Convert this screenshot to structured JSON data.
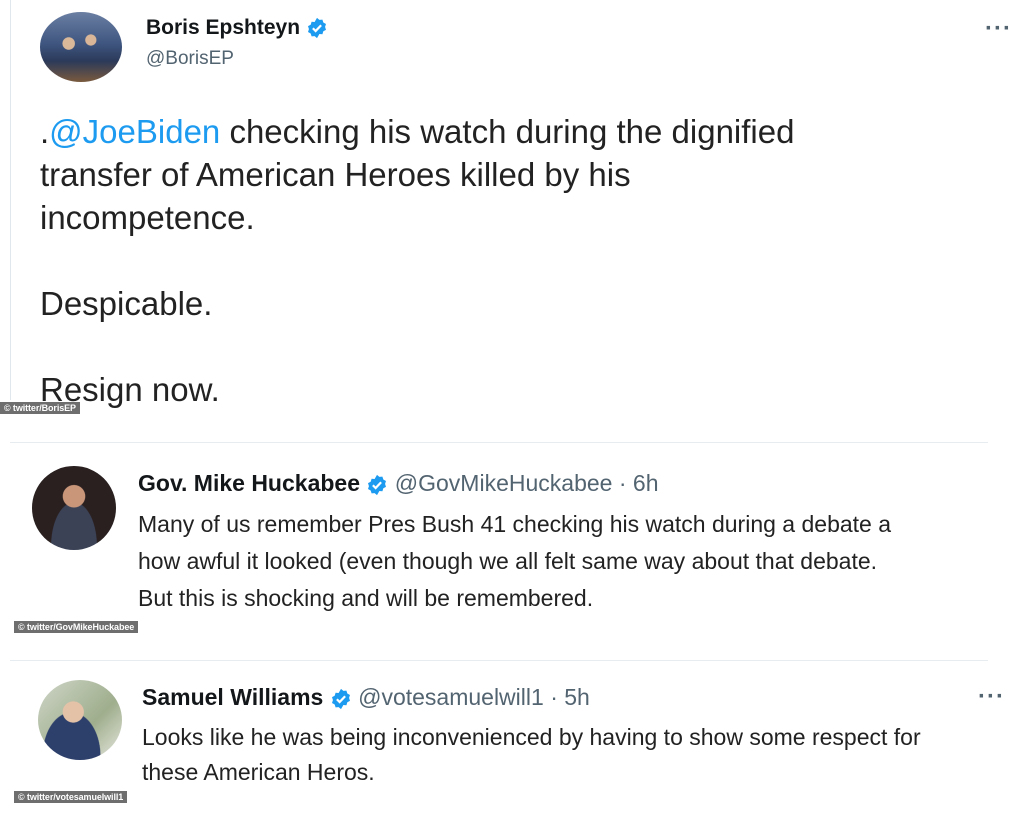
{
  "tweets": [
    {
      "name": "Boris Epshteyn",
      "handle": "@BorisEP",
      "verified": true,
      "mention": "@JoeBiden",
      "prefix": ".",
      "text_after_mention": " checking his watch during the dignified",
      "line2": "transfer of American Heroes killed by his",
      "line3": "incompetence.",
      "line4": "Despicable.",
      "line5": "Resign now.",
      "credit": "© twitter/BorisEP",
      "more": "···"
    },
    {
      "name": "Gov. Mike Huckabee",
      "handle": "@GovMikeHuckabee",
      "separator": "·",
      "time": "6h",
      "verified": true,
      "lines": [
        "Many of us remember Pres Bush 41 checking his watch during a debate a",
        "how awful it looked (even though we all felt same way about that debate.",
        "But this is shocking and will be remembered."
      ],
      "credit": "© twitter/GovMikeHuckabee"
    },
    {
      "name": "Samuel Williams",
      "handle": "@votesamuelwill1",
      "separator": "·",
      "time": "5h",
      "verified": true,
      "lines": [
        "Looks like he was being inconvenienced by having to show some respect for",
        "these American Heros."
      ],
      "credit": "© twitter/votesamuelwill1",
      "more": "···"
    }
  ],
  "colors": {
    "verified_blue": "#1d9bf0",
    "mention_blue": "#1d9bf0",
    "muted": "#536471"
  },
  "icons": {
    "verified": "verified-badge-icon",
    "more": "more-options-icon"
  }
}
